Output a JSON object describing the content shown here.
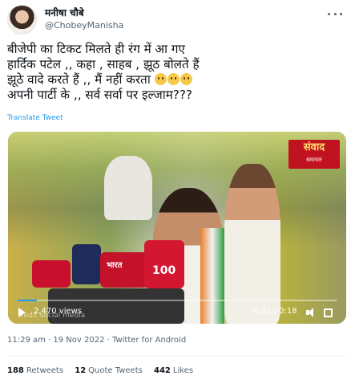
{
  "author": {
    "display_name": "मनीषा चौबे",
    "handle": "@ChobeyManisha"
  },
  "tweet": {
    "lines": [
      "बीजेपी का टिकट मिलते ही रंग में आ गए",
      "हार्दिक पटेल ,, कहा , साहब , झूठ बोलते हैं",
      "झूठे वादे करते हैं ,, मैं नहीं करता",
      "अपनी पार्टी के ,, सर्व सर्वा पर इल्जाम???"
    ],
    "emojis": [
      "grinning-squinting-face",
      "grinning-face",
      "worried-face"
    ],
    "translate_label": "Translate Tweet"
  },
  "video": {
    "channel_logo_main": "संवाद",
    "channel_logo_sub": "समाचार",
    "mic_label_1": "भारत",
    "mic_label_2": "100",
    "watermark": "redit social media",
    "views": "2,470 views",
    "time": "0:01 / 0:18",
    "progress_fraction": 0.06
  },
  "meta": {
    "timestamp": "11:29 am · 19 Nov 2022 · Twitter for Android"
  },
  "stats": [
    {
      "count": "188",
      "label": "Retweets"
    },
    {
      "count": "12",
      "label": "Quote Tweets"
    },
    {
      "count": "442",
      "label": "Likes"
    }
  ],
  "colors": {
    "link": "#1d9bf0",
    "secondary_text": "#536471",
    "primary_text": "#0f1419",
    "logo_red": "#c0121f"
  }
}
